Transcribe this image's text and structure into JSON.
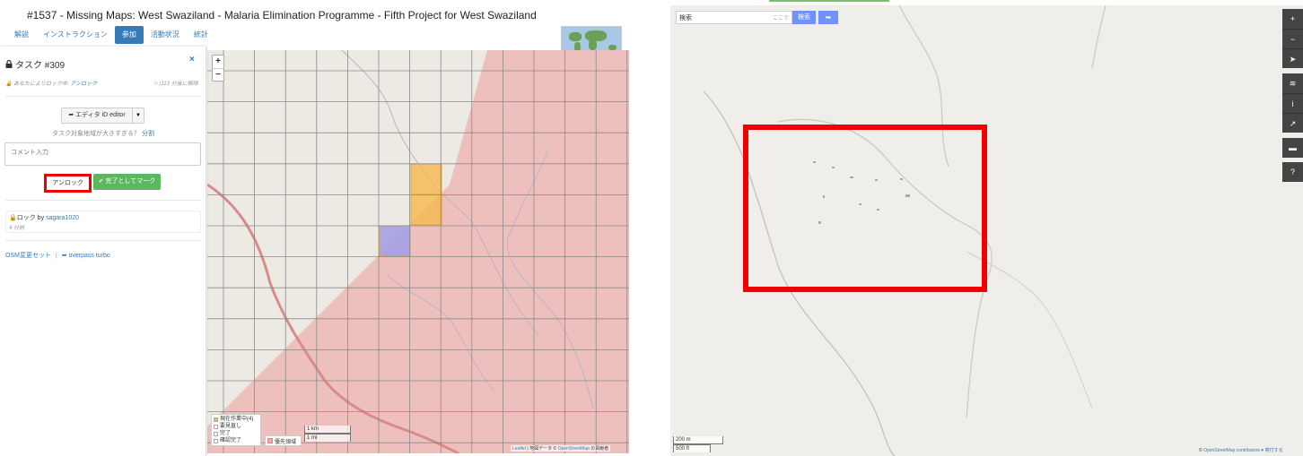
{
  "tm": {
    "title": "#1537 - Missing Maps: West Swaziland - Malaria Elimination Programme - Fifth Project for West Swaziland",
    "tabs": [
      {
        "label": "解説",
        "active": false
      },
      {
        "label": "インストラクション",
        "active": false
      },
      {
        "label": "参加",
        "active": true
      },
      {
        "label": "活動状況",
        "active": false
      },
      {
        "label": "統計",
        "active": false
      }
    ],
    "task": {
      "heading": "タスク #309",
      "close": "×",
      "lock_prefix": "あなたによりロック中.",
      "lock_link": "アンロック",
      "time": "(113 分後に解除",
      "editor_label": "エディタ iD editor",
      "too_big_prefix": "タスク対象地域が大きすぎる？",
      "split_link": "分割",
      "comment_placeholder": "コメント入力",
      "unlock_label": "アンロック",
      "done_label": "完了としてマーク"
    },
    "history": {
      "action": "ロック",
      "by": "by",
      "user": "sagara1020",
      "ago": "4 分前"
    },
    "links": {
      "changesets": "OSM変更セット",
      "overpass": "overpass turbo"
    },
    "map": {
      "zoom_in": "+",
      "zoom_out": "−",
      "legend": [
        {
          "label": "現在作業中(4)",
          "color": "#f5b94f"
        },
        {
          "label": "要見直し",
          "color": "#ffffff"
        },
        {
          "label": "完了",
          "color": "#ffffff"
        },
        {
          "label": "確認完了",
          "color": "#ffffff"
        }
      ],
      "legend2": "優先領域",
      "scale_km": "1 km",
      "scale_mi": "1 mi",
      "attribution_leaflet": "Leaflet",
      "attribution_text": "| 地図データ ©",
      "attribution_osm": "OpenStreetMap",
      "attribution_suffix": "の貢献者"
    }
  },
  "osm": {
    "search_value": "検索",
    "search_here": "ここで",
    "search_button": "検索",
    "controls_top": [
      "+",
      "−",
      "➤"
    ],
    "controls_mid": [
      "≋",
      "i",
      "↗"
    ],
    "controls_help": [
      "▬"
    ],
    "controls_q": [
      "?"
    ],
    "scale_m": "200 m",
    "scale_ft": "500 ft",
    "attribution_prefix": "©",
    "attribution_link": "OpenStreetMap contributors",
    "attribution_suffix": "♥ 寄付する"
  },
  "colors": {
    "accent": "#337ab7",
    "success": "#5cb85c",
    "highlight": "#f00000",
    "priority_area": "#f0a9a9",
    "working": "#f5b94f",
    "locked_self": "#9f9ee6",
    "osm_button": "#7092ff"
  }
}
